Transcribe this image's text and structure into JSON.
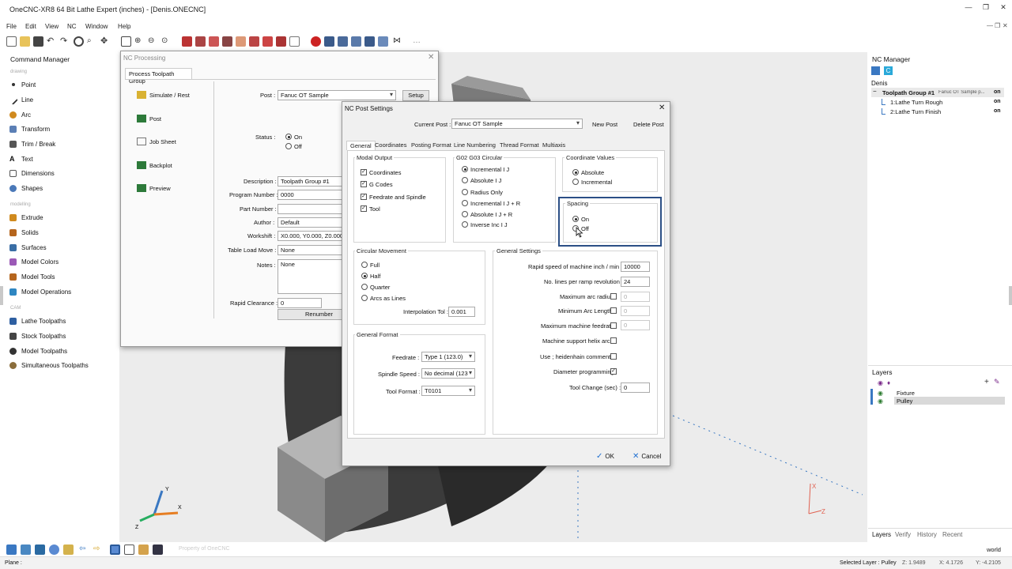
{
  "app": {
    "title": "OneCNC-XR8  64 Bit Lathe Expert (inches) - [Denis.ONECNC]"
  },
  "menu": [
    "File",
    "Edit",
    "View",
    "NC",
    "Window",
    "Help"
  ],
  "command_manager": {
    "title": "Command Manager",
    "sections": {
      "drawing": "drawing",
      "modelling": "modelling",
      "cam": "CAM"
    },
    "drawing_items": [
      "Point",
      "Line",
      "Arc",
      "Transform",
      "Trim / Break",
      "Text",
      "Dimensions",
      "Shapes"
    ],
    "modelling_items": [
      "Extrude",
      "Solids",
      "Surfaces",
      "Model Colors",
      "Model Tools",
      "Model Operations"
    ],
    "cam_items": [
      "Lathe Toolpaths",
      "Stock Toolpaths",
      "Model Toolpaths",
      "Simultaneous Toolpaths"
    ]
  },
  "nc_processing": {
    "title": "NC Processing",
    "tab": "Process Toolpath Group",
    "side_buttons": [
      "Simulate / Rest",
      "Post",
      "Job Sheet",
      "Backplot",
      "Preview"
    ],
    "post_label": "Post :",
    "post_value": "Fanuc OT Sample",
    "setup_label": "Setup",
    "status_label": "Status :",
    "status_on": "On",
    "status_off": "Off",
    "description_label": "Description :",
    "description_value": "Toolpath Group #1",
    "program_number_label": "Program Number :",
    "program_number_value": "0000",
    "part_number_label": "Part Number :",
    "part_number_value": "",
    "author_label": "Author :",
    "author_value": "Default",
    "workshift_label": "Workshift :",
    "workshift_value": "X0.000, Y0.000, Z0.000",
    "table_load_label": "Table Load Move :",
    "table_load_value": "None",
    "notes_label": "Notes :",
    "notes_value": "None",
    "rapid_clearance_label": "Rapid Clearance :",
    "rapid_clearance_value": "0",
    "renumber_label": "Renumber ope"
  },
  "post_settings": {
    "title": "NC Post Settings",
    "current_post_label": "Current Post :",
    "current_post_value": "Fanuc OT Sample",
    "new_post": "New Post",
    "delete_post": "Delete Post",
    "tabs": [
      "General",
      "Coordinates",
      "Posting Format",
      "Line Numbering",
      "Thread Format",
      "Multiaxis"
    ],
    "modal_output": {
      "title": "Modal Output",
      "items": [
        "Coordinates",
        "G Codes",
        "Feedrate and Spindle",
        "Tool"
      ]
    },
    "circular": {
      "title": "G02 G03 Circular",
      "items": [
        "Incremental I J",
        "Absolute I J",
        "Radius Only",
        "Incremental I J + R",
        "Absolute I J + R",
        "Inverse Inc I J"
      ]
    },
    "coordinate_values": {
      "title": "Coordinate Values",
      "items": [
        "Absolute",
        "Incremental"
      ]
    },
    "spacing": {
      "title": "Spacing",
      "items": [
        "On",
        "Off"
      ]
    },
    "circular_movement": {
      "title": "Circular Movement",
      "items": [
        "Full",
        "Half",
        "Quarter",
        "Arcs as Lines"
      ],
      "interp_label": "Interpolation Tol :",
      "interp_value": "0.001"
    },
    "general_format": {
      "title": "General Format",
      "feedrate_label": "Feedrate :",
      "feedrate_value": "Type 1 (123.0)",
      "spindle_label": "Spindle Speed :",
      "spindle_value": "No decimal (123",
      "toolformat_label": "Tool Format :",
      "toolformat_value": "T0101"
    },
    "general_settings": {
      "title": "General Settings",
      "rapid_label": "Rapid speed of machine inch / min :",
      "rapid_value": "10000",
      "lines_label": "No. lines per ramp revolution :",
      "lines_value": "24",
      "max_arc_label": "Maximum arc radius",
      "max_arc_value": "0",
      "min_arc_label": "Minimum Arc Length",
      "min_arc_value": "0",
      "max_feed_label": "Maximum machine feedrate",
      "max_feed_value": "0",
      "helix_label": "Machine support helix arcs",
      "heidenhain_label": "Use ; heidenhain comments",
      "diameter_label": "Diameter programming",
      "toolchange_label": "Tool Change (sec) :",
      "toolchange_value": "0"
    },
    "ok": "OK",
    "cancel": "Cancel"
  },
  "nc_manager": {
    "title": "NC Manager",
    "user": "Denis",
    "group": "Toolpath Group #1",
    "group_post": "Fanuc OT Sample p...",
    "group_state": "on",
    "items": [
      {
        "label": "1:Lathe Turn Rough",
        "state": "on"
      },
      {
        "label": "2:Lathe Turn Finish",
        "state": "on"
      }
    ]
  },
  "layers": {
    "title": "Layers",
    "items": [
      "Fixture",
      "Pulley"
    ],
    "tabs": [
      "Layers",
      "Verify",
      "History",
      "Recent"
    ],
    "world": "world"
  },
  "viewport": {
    "watermark": "Property of OneCNC"
  },
  "status": {
    "plane": "Plane :",
    "selected_layer": "Selected Layer : Pulley",
    "z": "Z: 1.9489",
    "x": "X: 4.1726",
    "y": "Y: -4.2105"
  }
}
